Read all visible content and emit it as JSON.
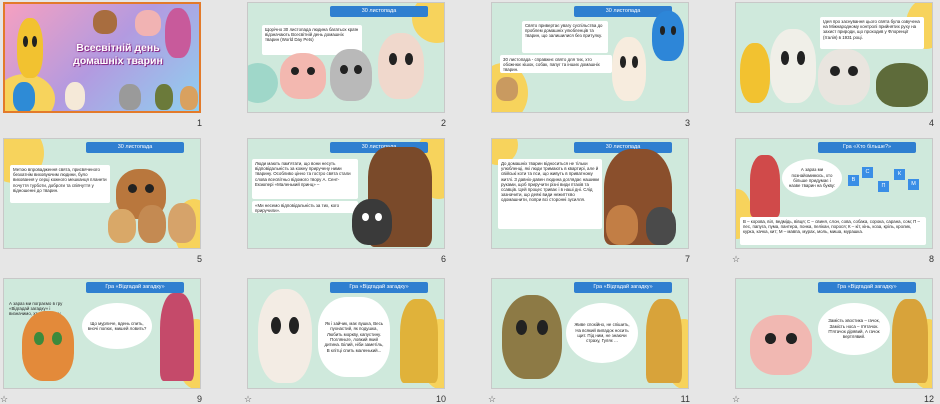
{
  "slides": [
    {
      "num": "1",
      "title": "Всесвітній день домашніх тварин"
    },
    {
      "num": "2",
      "banner": "30 листопада",
      "text": "Щорічно 30 листопада людина багатьох країн відзначають Всесвітній день домашніх тварин (World Day Pets)"
    },
    {
      "num": "3",
      "banner": "30 листопада",
      "text1": "Свято привертає увагу суспільства до проблем домашніх улюбленців та тварин, що залишилися без притулку.",
      "text2": "30 листопада - справжнє свято для тих, хто обожнює кішок, собак, папуг та інших домашніх тварин."
    },
    {
      "num": "4",
      "text": "Ідея про заснування цього свята була озвучена на Міжнародному контролі прийнятих руху на захист природи, що проходив у Флоренції (Італія) в 1931 році."
    },
    {
      "num": "5",
      "banner": "30 листопада",
      "text": "Метою впровадження свята, присвяченого безхатнім виховуючим людини, було виховання у серці кожного мешканця планети почуття турботи, доброти та співчуття у відношенні до тварин."
    },
    {
      "num": "6",
      "banner": "30 листопада",
      "text1": "Люди мають пам'ятати, що вони несуть відповідальність за кожну приручену ними тварину. Особливо цінно та гостро свята стали слова всесвітньо відомого твору А. Сент-Екзюпері «Маленький принц» –",
      "text2": "«Ми несемо відповідальність за тих, кого приручили»."
    },
    {
      "num": "7",
      "banner": "30 листопада",
      "text": "До домашніх тварин відноситься не тільки улюбленці, які люди тримають в квартирі, але й свійські коти та пси, що живуть в приватному житлі. З давніх-давен людина доглядає нашими руками, щоб приручити різні види птахів та ссавців. Цей процес триває і в наші дні. Слід зазначити, що деякі види нежиттєво одомашнити, попри всі сторонні зусилля."
    },
    {
      "num": "8",
      "banner": "Гра «Хто більше?»",
      "text1": "А зараз ми познайомимось, хто більше придумає і назве тварин на букву:",
      "letters": [
        "В",
        "С",
        "П",
        "К",
        "М"
      ],
      "list": "В – корова, віл, ведмідь, вівця; С – свиня, слон, сова, собака, сорока, сарана, сом; П – пес, папуга, пума, пантера, понка, пелікан, порося; К – кіт, кінь, коза, кріль, кролик, курка, качка, кит; М – мавпа, мурах, моль, миша, мурашка."
    },
    {
      "num": "9",
      "banner": "Гра «Відгадай загадку»",
      "text1": "А зараз ми пограємо в гру «Відгадай загадку» і визначимо, хто в нашому класі найрозумніший!",
      "riddle": "Що мурличе, вдень спить, вночі полює, мишей ловить?"
    },
    {
      "num": "10",
      "banner": "Гра «Відгадай загадку»",
      "riddle": "Як і зайчик, має вушка, Весь пухнастий, як подушка, Любить моркву, капустину. Погляньте, ловкий який дитина. Білий, ніби заметіль, В клітці спить маленький..."
    },
    {
      "num": "11",
      "banner": "Гра «Відгадай загадку»",
      "riddle": "Живе спокійно, не спішить, На всякий випадок носить щит. Під ним, не знаючи страху, Гуляє ..."
    },
    {
      "num": "12",
      "banner": "Гра «Відгадай загадку»",
      "riddle": "Замість хвостика – гачок, Замість носа – п'ятачок. П'ятачок дірявий, А гачок вертлявий."
    }
  ],
  "colors": {
    "accent": "#e37a2a",
    "banner": "#2f7fd0",
    "mint": "#cfe9dc"
  },
  "icons": {
    "star": "star-icon",
    "transition": "transition-icon"
  }
}
